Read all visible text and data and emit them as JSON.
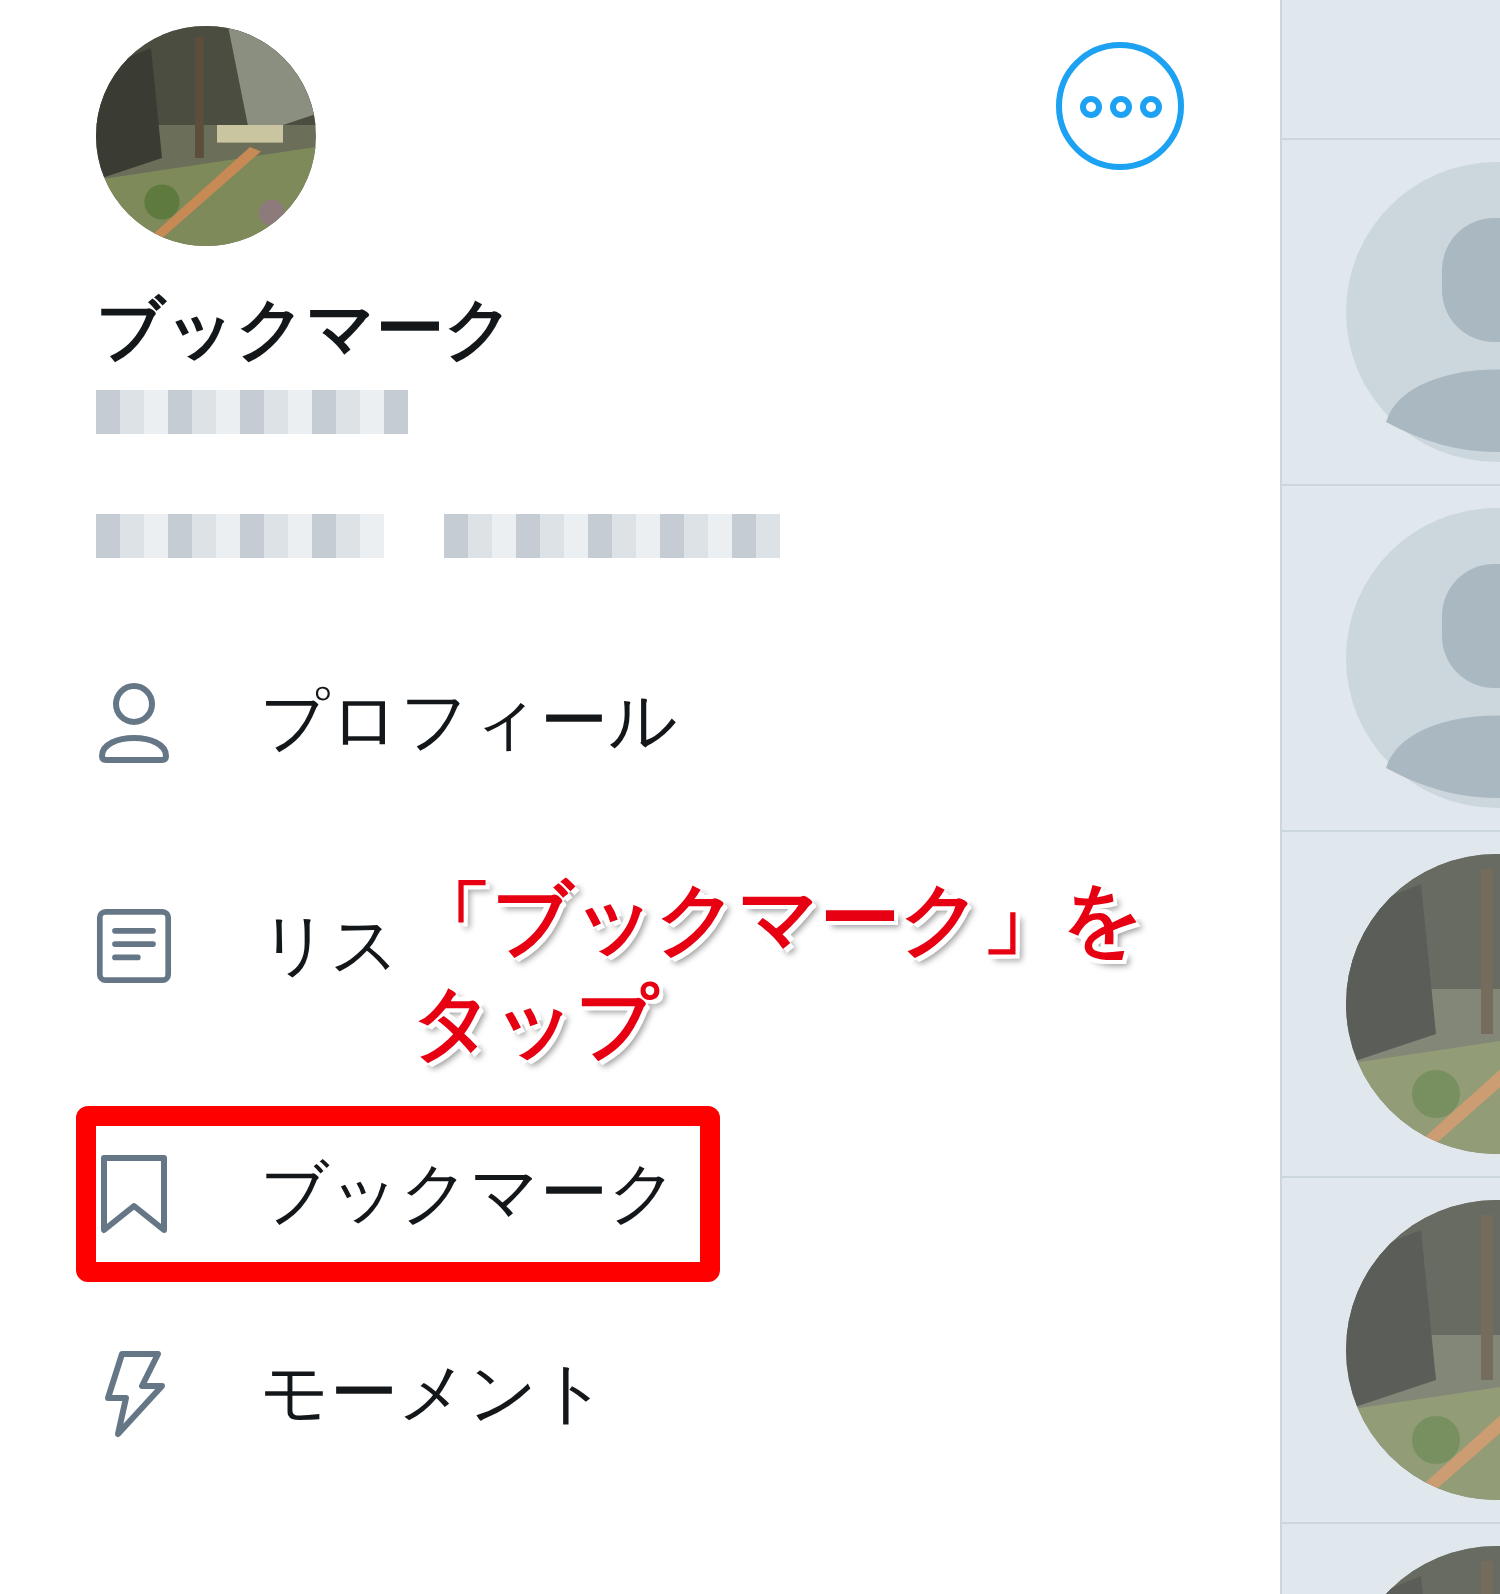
{
  "profile": {
    "name": "ブックマーク"
  },
  "menu": [
    {
      "kind": "profile",
      "label": "プロフィール",
      "highlighted": false
    },
    {
      "kind": "list",
      "label": "リス",
      "highlighted": false
    },
    {
      "kind": "bookmark",
      "label": "ブックマーク",
      "highlighted": true
    },
    {
      "kind": "moments",
      "label": "モーメント",
      "highlighted": false
    }
  ],
  "annotation": {
    "lines": [
      "「ブックマーク」を",
      "タップ"
    ]
  },
  "timeline": [
    {
      "kind": "empty"
    },
    {
      "kind": "default"
    },
    {
      "kind": "default"
    },
    {
      "kind": "picture"
    },
    {
      "kind": "picture"
    },
    {
      "kind": "picture"
    }
  ]
}
